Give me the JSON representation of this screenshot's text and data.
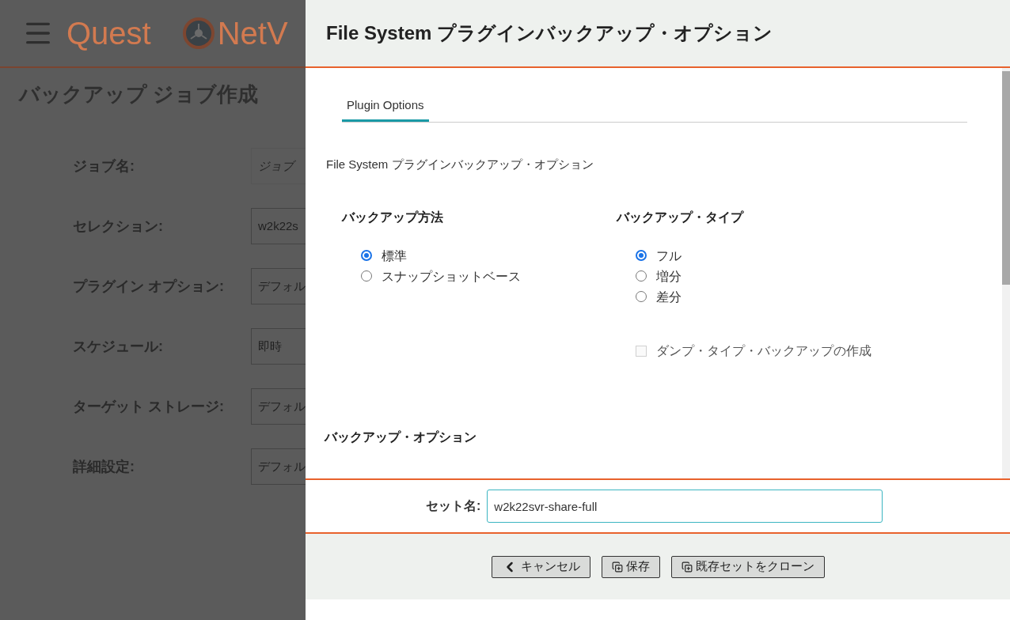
{
  "background_page": {
    "logo": "Quest",
    "product": "NetV",
    "title": "バックアップ ジョブ作成",
    "fields": [
      {
        "label": "ジョブ名:",
        "placeholder": "ジョブ"
      },
      {
        "label": "セレクション:",
        "value": "w2k22s"
      },
      {
        "label": "プラグイン オプション:",
        "value": "デフォル"
      },
      {
        "label": "スケジュール:",
        "value": "即時"
      },
      {
        "label": "ターゲット ストレージ:",
        "value": "デフォル"
      },
      {
        "label": "詳細設定:",
        "value": "デフォル"
      }
    ]
  },
  "dialog": {
    "title": "File System プラグインバックアップ・オプション",
    "tabs": [
      {
        "label": "Plugin Options",
        "selected": true
      }
    ],
    "section_title": "File System プラグインバックアップ・オプション",
    "groups": [
      {
        "heading": "バックアップ方法",
        "options": [
          {
            "label": "標準",
            "selected": true
          },
          {
            "label": "スナップショットベース",
            "selected": false
          }
        ]
      },
      {
        "heading": "バックアップ・タイプ",
        "options": [
          {
            "label": "フル",
            "selected": true
          },
          {
            "label": "増分",
            "selected": false
          },
          {
            "label": "差分",
            "selected": false
          }
        ],
        "checkbox": {
          "label": "ダンプ・タイプ・バックアップの作成",
          "checked": false,
          "disabled": true
        }
      }
    ],
    "subsection": "バックアップ・オプション",
    "set_name": {
      "label": "セット名:",
      "value": "w2k22svr-share-full"
    },
    "buttons": [
      {
        "label": "キャンセル",
        "kind": "back"
      },
      {
        "label": "保存",
        "kind": "copy"
      },
      {
        "label": "既存セットをクローン",
        "kind": "copy"
      }
    ]
  }
}
